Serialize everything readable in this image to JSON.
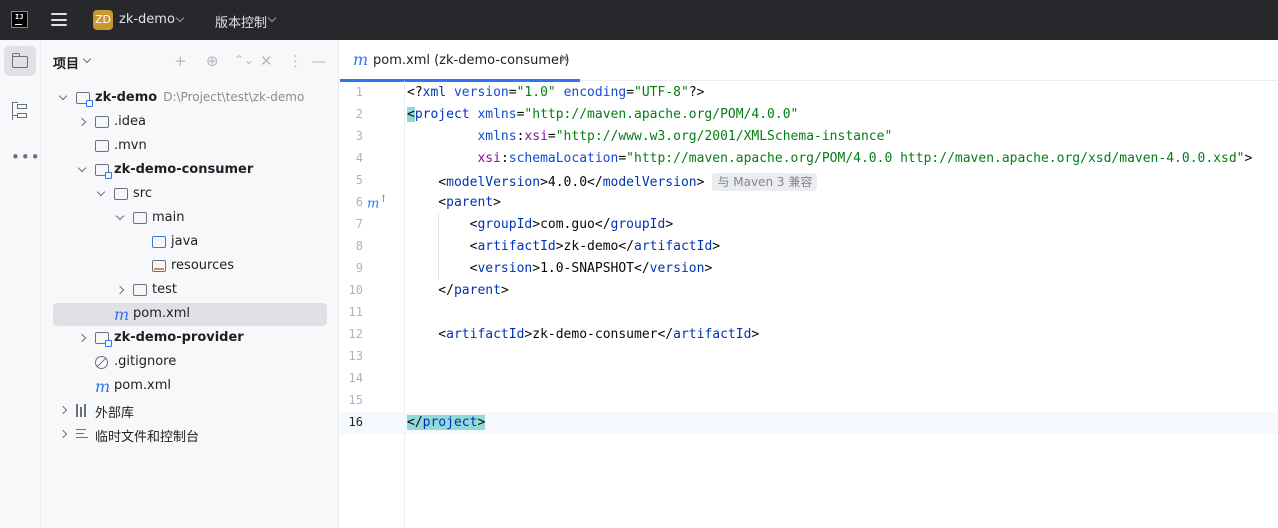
{
  "titlebar": {
    "project_badge": "ZD",
    "project_name": "zk-demo",
    "vcs_label": "版本控制"
  },
  "project_panel": {
    "title": "项目",
    "tree": [
      {
        "label": "zk-demo",
        "path": "D:\\Project\\test\\zk-demo",
        "bold": true,
        "icon": "module-folder-icon",
        "expanded": true,
        "depth": 0
      },
      {
        "label": ".idea",
        "icon": "folder-icon",
        "expanded": false,
        "depth": 1
      },
      {
        "label": ".mvn",
        "icon": "folder-icon",
        "depth": 1
      },
      {
        "label": "zk-demo-consumer",
        "bold": true,
        "icon": "module-folder-icon",
        "expanded": true,
        "depth": 1
      },
      {
        "label": "src",
        "icon": "folder-icon",
        "expanded": true,
        "depth": 2
      },
      {
        "label": "main",
        "icon": "folder-icon",
        "expanded": true,
        "depth": 3
      },
      {
        "label": "java",
        "icon": "source-folder-icon",
        "depth": 4
      },
      {
        "label": "resources",
        "icon": "resources-folder-icon",
        "depth": 4
      },
      {
        "label": "test",
        "icon": "folder-icon",
        "expanded": false,
        "depth": 3
      },
      {
        "label": "pom.xml",
        "icon": "maven-icon",
        "selected": true,
        "depth": 2
      },
      {
        "label": "zk-demo-provider",
        "bold": true,
        "icon": "module-folder-icon",
        "expanded": false,
        "depth": 1
      },
      {
        "label": ".gitignore",
        "icon": "ignore-file-icon",
        "depth": 1
      },
      {
        "label": "pom.xml",
        "icon": "maven-icon",
        "depth": 1
      },
      {
        "label": "外部库",
        "icon": "library-icon",
        "expanded": false,
        "depth": 0
      },
      {
        "label": "临时文件和控制台",
        "icon": "scratches-icon",
        "expanded": false,
        "depth": 0
      }
    ]
  },
  "editor": {
    "tab": {
      "label": "pom.xml (zk-demo-consumer)",
      "close": "✕"
    },
    "current_line": 16,
    "gutter_mark_line": 6,
    "lines": [
      {
        "n": "1",
        "html": "&lt;?<span class='t'>xml</span> <span class='a'>version</span>=<span class='s'>\"1.0\"</span> <span class='a'>encoding</span>=<span class='s'>\"UTF-8\"</span>?&gt;"
      },
      {
        "n": "2",
        "html": "<span class='hl'>&lt;</span><span class='t'>project</span> <span class='a'>xmlns</span>=<span class='s'>\"http://maven.apache.org/POM/4.0.0\"</span>"
      },
      {
        "n": "3",
        "html": "         <span class='a'>xmlns</span>:<span class='ns'>xsi</span>=<span class='s'>\"http://www.w3.org/2001/XMLSchema-instance\"</span>"
      },
      {
        "n": "4",
        "html": "         <span class='ns'>xsi</span>:<span class='a'>schemaLocation</span>=<span class='s'>\"http://maven.apache.org/POM/4.0.0 http://maven.apache.org/xsd/maven-4.0.0.xsd\"</span>&gt;"
      },
      {
        "n": "5",
        "html": "    &lt;<span class='t'>modelVersion</span>&gt;4.0.0&lt;/<span class='t'>modelVersion</span>&gt;",
        "hint": "与 Maven 3 兼容"
      },
      {
        "n": "6",
        "html": "    &lt;<span class='t'>parent</span>&gt;"
      },
      {
        "n": "7",
        "html": "        &lt;<span class='t'>groupId</span>&gt;com.guo&lt;/<span class='t'>groupId</span>&gt;"
      },
      {
        "n": "8",
        "html": "        &lt;<span class='t'>artifactId</span>&gt;zk-demo&lt;/<span class='t'>artifactId</span>&gt;"
      },
      {
        "n": "9",
        "html": "        &lt;<span class='t'>version</span>&gt;1.0-SNAPSHOT&lt;/<span class='t'>version</span>&gt;"
      },
      {
        "n": "10",
        "html": "    &lt;/<span class='t'>parent</span>&gt;"
      },
      {
        "n": "11",
        "html": ""
      },
      {
        "n": "12",
        "html": "    &lt;<span class='t'>artifactId</span>&gt;zk-demo-consumer&lt;/<span class='t'>artifactId</span>&gt;"
      },
      {
        "n": "13",
        "html": ""
      },
      {
        "n": "14",
        "html": ""
      },
      {
        "n": "15",
        "html": ""
      },
      {
        "n": "16",
        "html": "<span class='hl'>&lt;/<span class='t'>project</span>&gt;</span>"
      }
    ]
  }
}
